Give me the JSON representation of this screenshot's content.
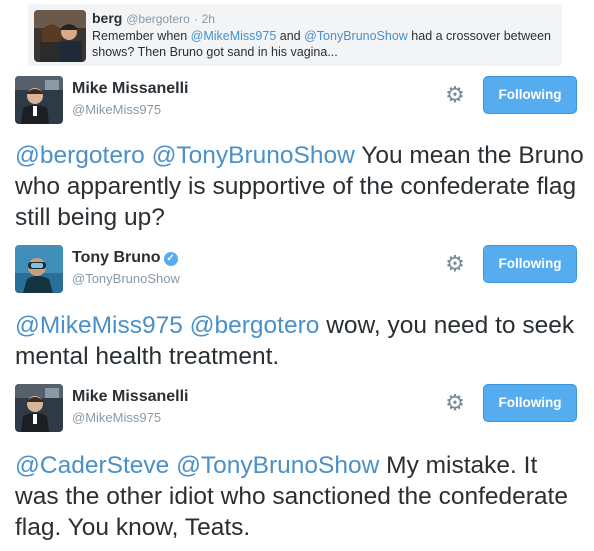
{
  "quoted": {
    "name": "berg",
    "handle": "@bergotero",
    "separator": "·",
    "time": "2h",
    "text_parts": [
      "Remember when ",
      "@MikeMiss975",
      " and ",
      "@TonyBrunoShow",
      " had a crossover between shows? Then Bruno got sand in his vagina..."
    ]
  },
  "tweets": [
    {
      "name": "Mike Missanelli",
      "handle": "@MikeMiss975",
      "verified": false,
      "follow_label": "Following",
      "text_parts": [
        {
          "t": "@bergotero",
          "link": true
        },
        {
          "t": " ",
          "link": false
        },
        {
          "t": "@TonyBrunoShow",
          "link": true
        },
        {
          "t": " You mean the Bruno who apparently is supportive of the confederate flag still being up?",
          "link": false
        }
      ]
    },
    {
      "name": "Tony Bruno",
      "handle": "@TonyBrunoShow",
      "verified": true,
      "verified_glyph": "✓",
      "follow_label": "Following",
      "text_parts": [
        {
          "t": "@MikeMiss975",
          "link": true
        },
        {
          "t": " ",
          "link": false
        },
        {
          "t": "@bergotero",
          "link": true
        },
        {
          "t": " wow, you need to seek mental health treatment.",
          "link": false
        }
      ]
    },
    {
      "name": "Mike Missanelli",
      "handle": "@MikeMiss975",
      "verified": false,
      "follow_label": "Following",
      "text_parts": [
        {
          "t": "@CaderSteve",
          "link": true
        },
        {
          "t": " ",
          "link": false
        },
        {
          "t": "@TonyBrunoShow",
          "link": true
        },
        {
          "t": " My mistake. It was the other idiot who sanctioned the confederate flag. You know, Teats.",
          "link": false
        }
      ]
    }
  ],
  "icons": {
    "gear": "gear-icon",
    "verified": "verified-badge-icon"
  },
  "colors": {
    "link": "#4a90c9",
    "follow_button": "#55acee"
  }
}
